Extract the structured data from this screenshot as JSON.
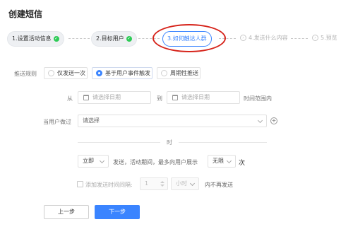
{
  "page": {
    "title": "创建短信"
  },
  "steps": [
    {
      "num": "1.",
      "label": "设置活动信息",
      "state": "done"
    },
    {
      "num": "2.",
      "label": "目标用户",
      "state": "done"
    },
    {
      "num": "3.",
      "label": "如何触达人群",
      "state": "active"
    },
    {
      "num": "4.",
      "label": "发送什么内容",
      "state": "todo"
    },
    {
      "num": "5.",
      "label": "预览",
      "state": "todo"
    }
  ],
  "push_rule": {
    "label": "推送规则",
    "options": [
      "仅发送一次",
      "基于用户事件触发",
      "周期性推送"
    ],
    "selected_index": 1
  },
  "date_range": {
    "from_label": "从",
    "start_placeholder": "请选择日期",
    "to_label": "到",
    "end_placeholder": "请选择日期",
    "suffix": "时间范围内"
  },
  "user_action": {
    "label": "当用户做过",
    "placeholder": "请选择",
    "add_icon": "plus-circle-icon"
  },
  "divider_text": "时",
  "send_config": {
    "timing_value": "立即",
    "middle_text": "发送，活动期间，最多向用户展示",
    "limit_value": "无限",
    "suffix": "次"
  },
  "interval": {
    "checkbox_label": "添加发送时间间隔:",
    "number_value": "1",
    "unit_value": "小时",
    "suffix": "内不再发送"
  },
  "buttons": {
    "prev": "上一步",
    "next": "下一步"
  },
  "colors": {
    "primary": "#3a84ff",
    "success": "#2dcb56",
    "highlight": "#d6241b"
  }
}
